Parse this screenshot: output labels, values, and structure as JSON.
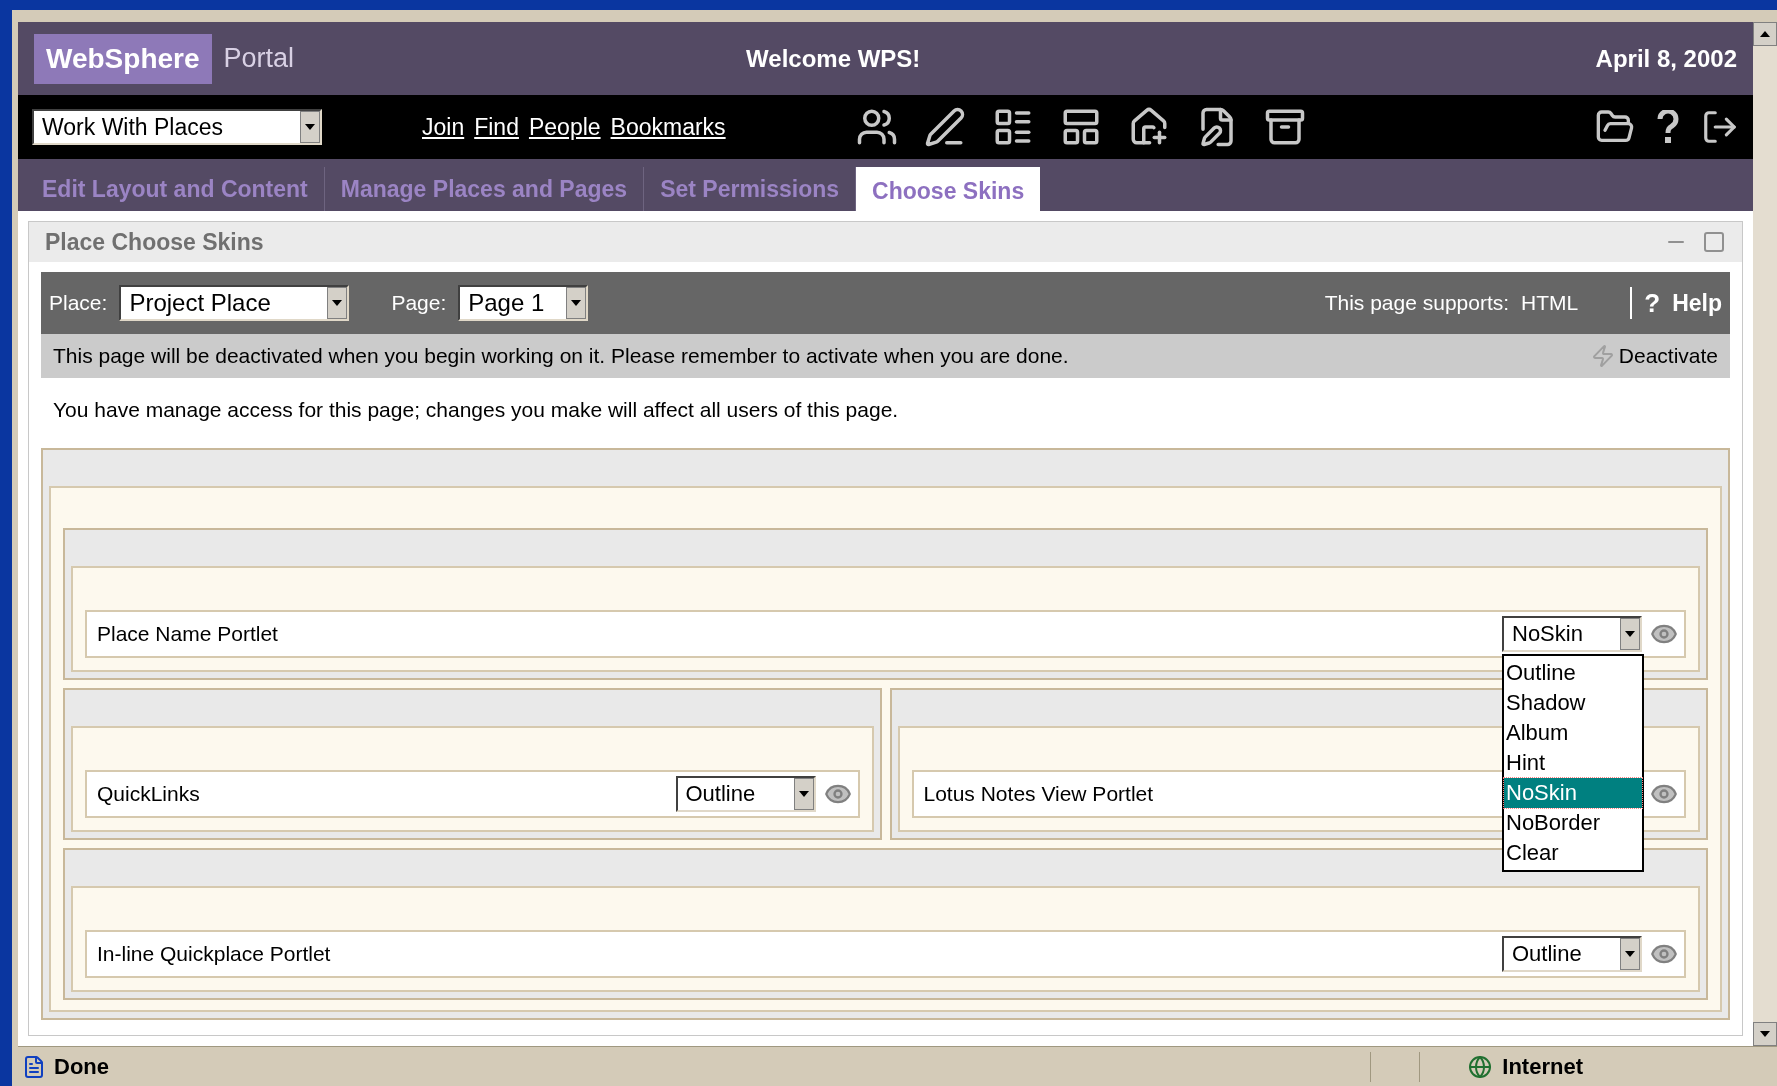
{
  "header": {
    "logo": "WebSphere",
    "product": "Portal",
    "welcome": "Welcome WPS!",
    "date": "April 8, 2002"
  },
  "toolbar": {
    "place_select": "Work With Places",
    "links": [
      "Join",
      "Find",
      "People",
      "Bookmarks"
    ]
  },
  "tabs": [
    {
      "label": "Edit Layout and Content",
      "selected": false
    },
    {
      "label": "Manage Places and Pages",
      "selected": false
    },
    {
      "label": "Set Permissions",
      "selected": false
    },
    {
      "label": "Choose Skins",
      "selected": true
    }
  ],
  "portlet": {
    "title": "Place Choose Skins",
    "place_label": "Place:",
    "place_value": "Project Place",
    "page_label": "Page:",
    "page_value": "Page 1",
    "supports_label": "This page supports:",
    "supports_value": "HTML",
    "help_mark": "?",
    "help": "Help",
    "notice": "This page will be deactivated when you begin working on it. Please remember to activate when you are done.",
    "deactivate": "Deactivate",
    "access_note": "You have manage access for this page; changes you make will affect all users of this page."
  },
  "layout": [
    {
      "portlets": [
        {
          "name": "Place Name Portlet",
          "skin": "NoSkin",
          "open": true
        }
      ]
    },
    {
      "portlets": [
        {
          "name": "QuickLinks",
          "skin": "Outline",
          "open": false
        },
        {
          "name": "Lotus Notes View Portlet",
          "open": false
        }
      ]
    },
    {
      "portlets": [
        {
          "name": "In-line Quickplace Portlet",
          "skin": "Outline",
          "open": false
        }
      ]
    }
  ],
  "skin_options": [
    {
      "label": "Outline",
      "selected": false
    },
    {
      "label": "Shadow",
      "selected": false
    },
    {
      "label": "Album",
      "selected": false
    },
    {
      "label": "Hint",
      "selected": false
    },
    {
      "label": "NoSkin",
      "selected": true
    },
    {
      "label": "NoBorder",
      "selected": false
    },
    {
      "label": "Clear",
      "selected": false
    }
  ],
  "status_bar": {
    "text": "Done",
    "zone": "Internet"
  }
}
